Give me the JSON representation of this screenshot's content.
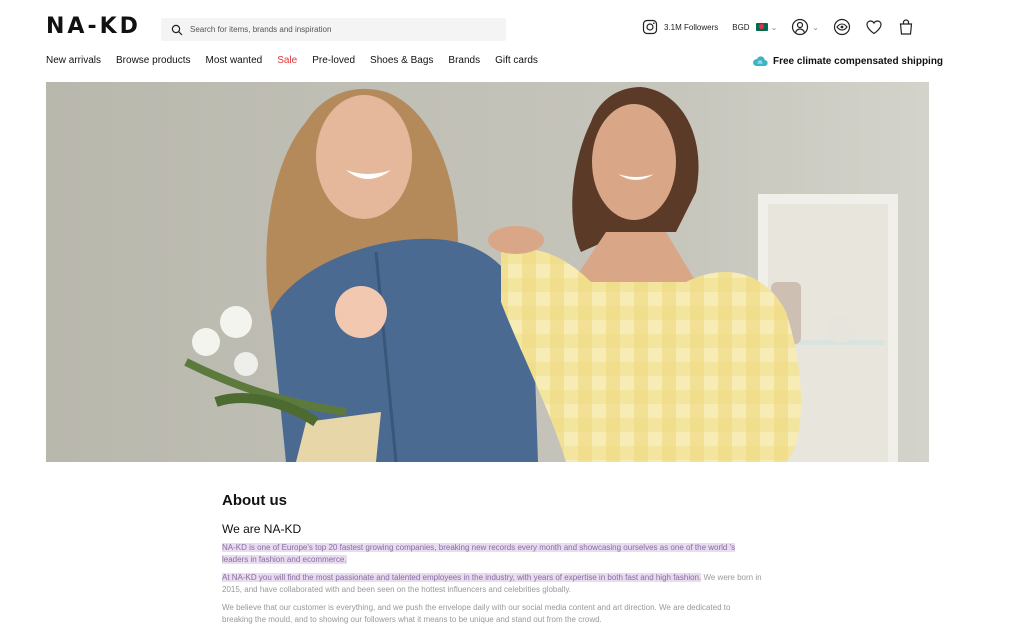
{
  "brand": {
    "logo_text": "NA-KD"
  },
  "search": {
    "placeholder": "Search for items, brands and inspiration"
  },
  "header_tools": {
    "instagram_followers": "3.1M Followers",
    "currency": "BGD",
    "icons": [
      "instagram-icon",
      "flag-icon",
      "account-icon",
      "visibility-icon",
      "wishlist-heart-icon",
      "cart-bag-icon"
    ]
  },
  "nav": {
    "items": [
      "New arrivals",
      "Browse products",
      "Most wanted",
      "Sale",
      "Pre-loved",
      "Shoes & Bags",
      "Brands",
      "Gift cards"
    ],
    "sale_color": "#e4363e"
  },
  "shipping": {
    "label": "Free climate compensated shipping",
    "icon": "cloud-icon",
    "icon_color": "#3fb3c6"
  },
  "hero": {
    "image": "Two women smiling, one in denim holding flowers, one in yellow gingham dress"
  },
  "about": {
    "title": "About us",
    "subtitle": "We are NA-KD",
    "p1": "NA-KD is one of Europe's top 20 fastest growing companies, breaking new records every month and showcasing ourselves as one of the world 's leaders in fashion and ecommerce.",
    "p2_highlight": "At NA-KD you will find the most passionate and talented employees in the industry, with years of expertise in both fast and high fashion.",
    "p2_rest": " We were born in 2015, and have collaborated with and been seen on the hottest influencers and celebrities globally.",
    "p3": "We believe that our customer is everything, and we push the envelope daily with our social media content and art direction. We are dedicated to breaking the mould, and to showing our followers what it means to be unique and stand out from the crowd."
  }
}
